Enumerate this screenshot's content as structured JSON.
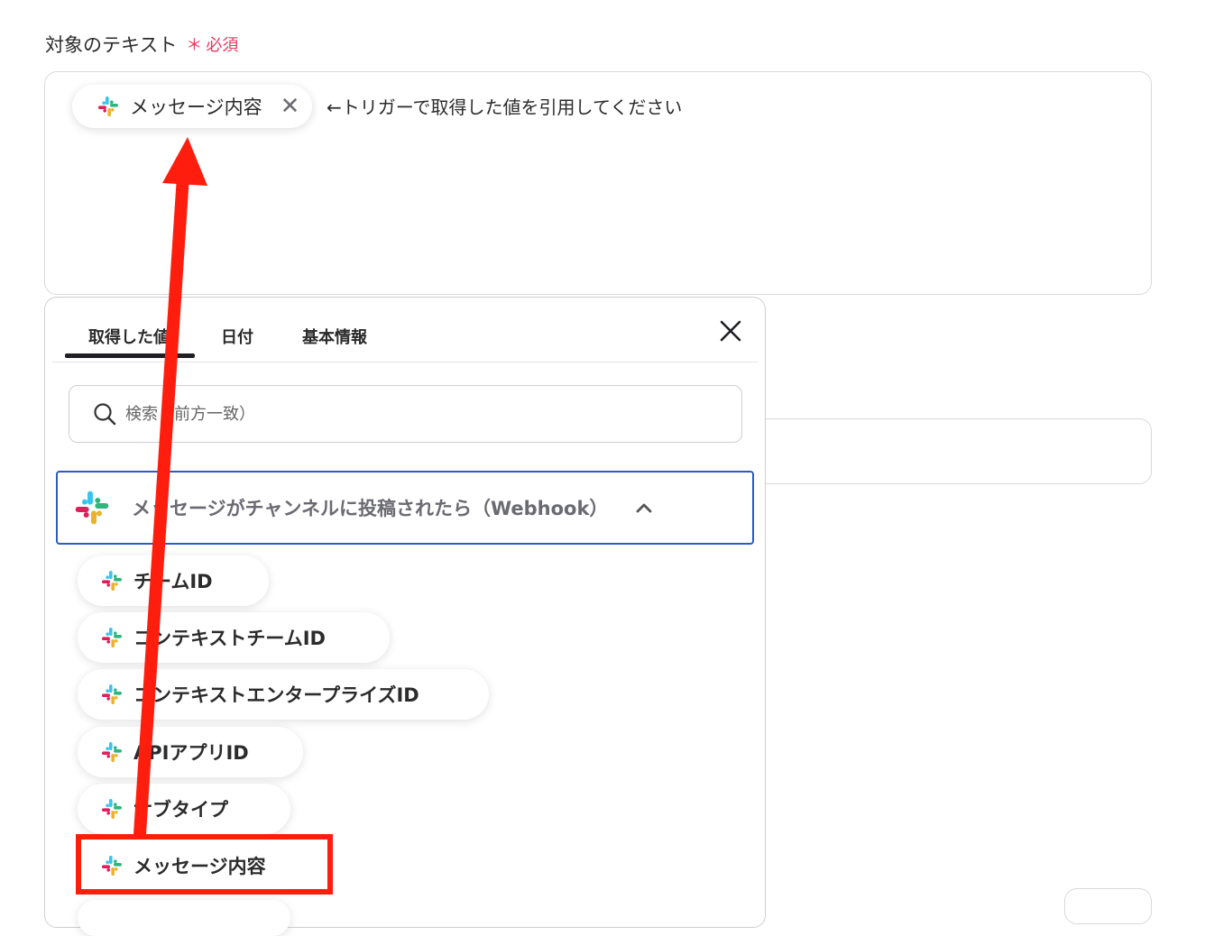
{
  "field": {
    "label": "対象のテキスト",
    "required_mark": "＊",
    "required_text": "必須",
    "chip_label": "メッセージ内容",
    "hint": "←トリガーで取得した値を引用してください"
  },
  "popup": {
    "tabs": [
      {
        "label": "取得した値",
        "active": true
      },
      {
        "label": "日付"
      },
      {
        "label": "基本情報"
      }
    ],
    "search": {
      "placeholder": "検索（前方一致）"
    },
    "group": {
      "title": "メッセージがチャンネルに投稿されたら（Webhook）",
      "expanded": true
    },
    "items": [
      {
        "label": "チームID"
      },
      {
        "label": "コンテキストチームID"
      },
      {
        "label": "コンテキストエンタープライズID"
      },
      {
        "label": "APIアプリID"
      },
      {
        "label": "サブタイプ"
      },
      {
        "label": "メッセージ内容",
        "highlighted": true
      }
    ]
  },
  "icons": [
    "slack-icon",
    "close-icon",
    "search-icon",
    "chevron-up-icon"
  ],
  "colors": {
    "required": "#e8375f",
    "group_border": "#2a5cc4",
    "annotation": "#ff1e0e",
    "tab_underline": "#1f1f24"
  }
}
